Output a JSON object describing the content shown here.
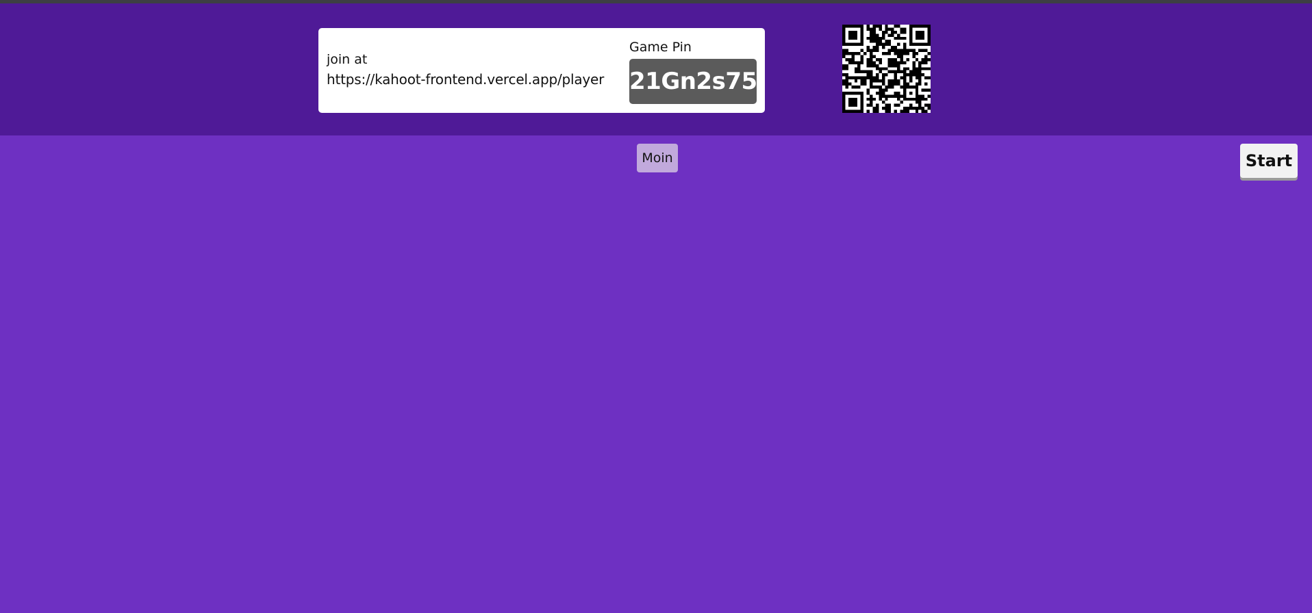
{
  "join": {
    "label": "join at",
    "url": "https://kahoot-frontend.vercel.app/player"
  },
  "game_pin": {
    "label": "Game Pin",
    "value": "21Gn2s75"
  },
  "qr_code": {
    "icon": "qr-code"
  },
  "players": [
    {
      "name": "Moin"
    }
  ],
  "start_button": {
    "label": "Start"
  },
  "colors": {
    "header_bg": "#4f1a97",
    "page_bg": "#6e30c2",
    "pin_box_bg": "#5b5b5b",
    "player_chip_bg": "#c1a9dc"
  }
}
